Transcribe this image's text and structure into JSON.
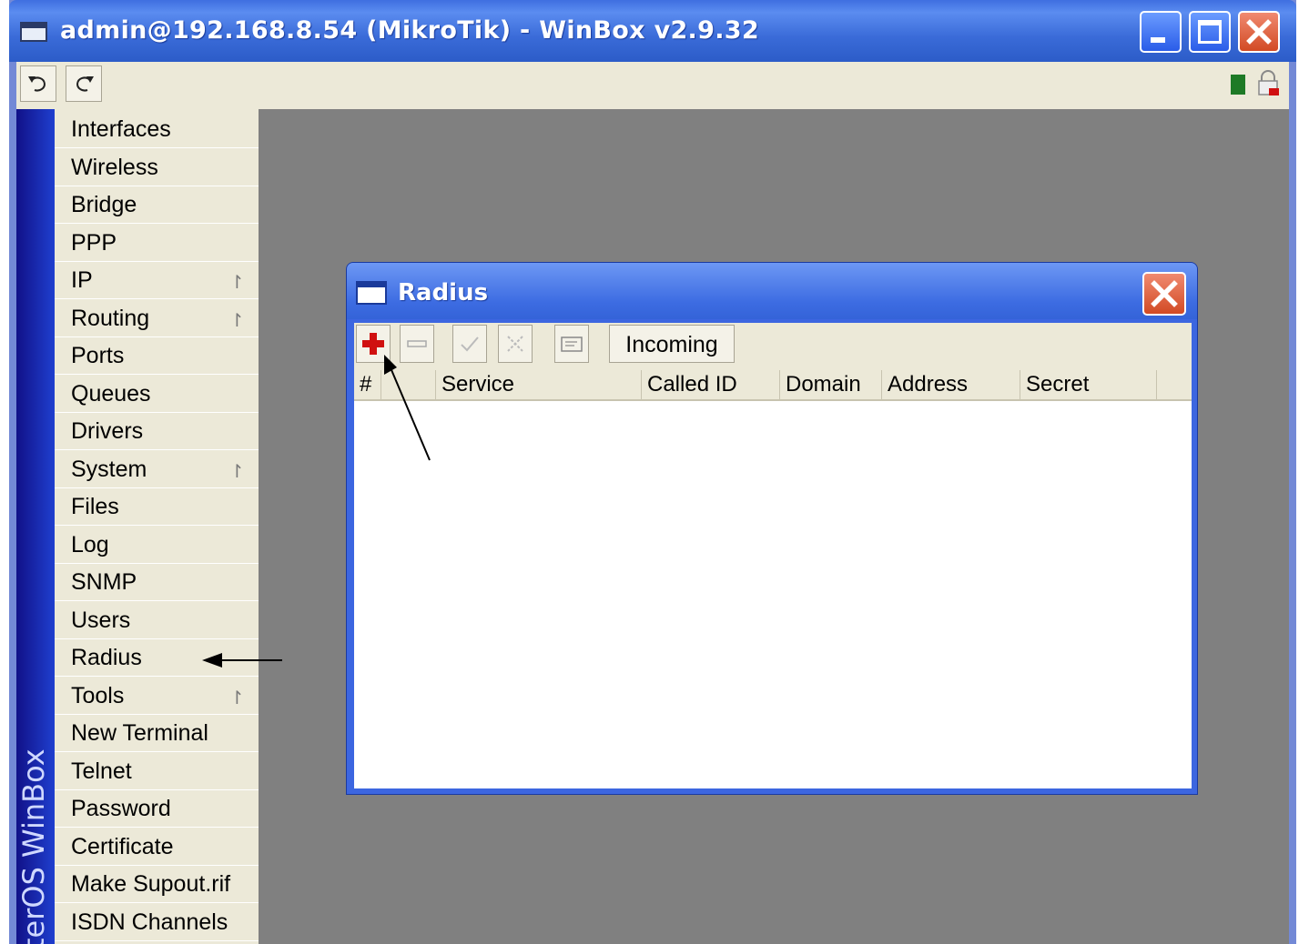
{
  "window": {
    "title": "admin@192.168.8.54 (MikroTik) - WinBox v2.9.32"
  },
  "brand_text": "terOS WinBox",
  "menu": {
    "items": [
      {
        "label": "Interfaces",
        "submenu": false
      },
      {
        "label": "Wireless",
        "submenu": false
      },
      {
        "label": "Bridge",
        "submenu": false
      },
      {
        "label": "PPP",
        "submenu": false
      },
      {
        "label": "IP",
        "submenu": true
      },
      {
        "label": "Routing",
        "submenu": true
      },
      {
        "label": "Ports",
        "submenu": false
      },
      {
        "label": "Queues",
        "submenu": false
      },
      {
        "label": "Drivers",
        "submenu": false
      },
      {
        "label": "System",
        "submenu": true
      },
      {
        "label": "Files",
        "submenu": false
      },
      {
        "label": "Log",
        "submenu": false
      },
      {
        "label": "SNMP",
        "submenu": false
      },
      {
        "label": "Users",
        "submenu": false
      },
      {
        "label": "Radius",
        "submenu": false
      },
      {
        "label": "Tools",
        "submenu": true
      },
      {
        "label": "New Terminal",
        "submenu": false
      },
      {
        "label": "Telnet",
        "submenu": false
      },
      {
        "label": "Password",
        "submenu": false
      },
      {
        "label": "Certificate",
        "submenu": false
      },
      {
        "label": "Make Supout.rif",
        "submenu": false
      },
      {
        "label": "ISDN Channels",
        "submenu": false
      }
    ],
    "submenu_glyph": "↾"
  },
  "dialog": {
    "title": "Radius",
    "incoming_label": "Incoming",
    "columns": [
      "#",
      "Service",
      "Called ID",
      "Domain",
      "Address",
      "Secret"
    ]
  },
  "icons": {
    "undo": "undo-icon",
    "redo": "redo-icon",
    "add": "add-icon",
    "remove": "remove-icon",
    "enable": "enable-icon",
    "disable": "disable-icon",
    "comment": "comment-icon"
  },
  "colors": {
    "titlebar": "#3a6bd8",
    "workspace": "#808080",
    "menu_bg": "#ece9d8",
    "close_button": "#d24a24",
    "status_green": "#1e7a26"
  }
}
